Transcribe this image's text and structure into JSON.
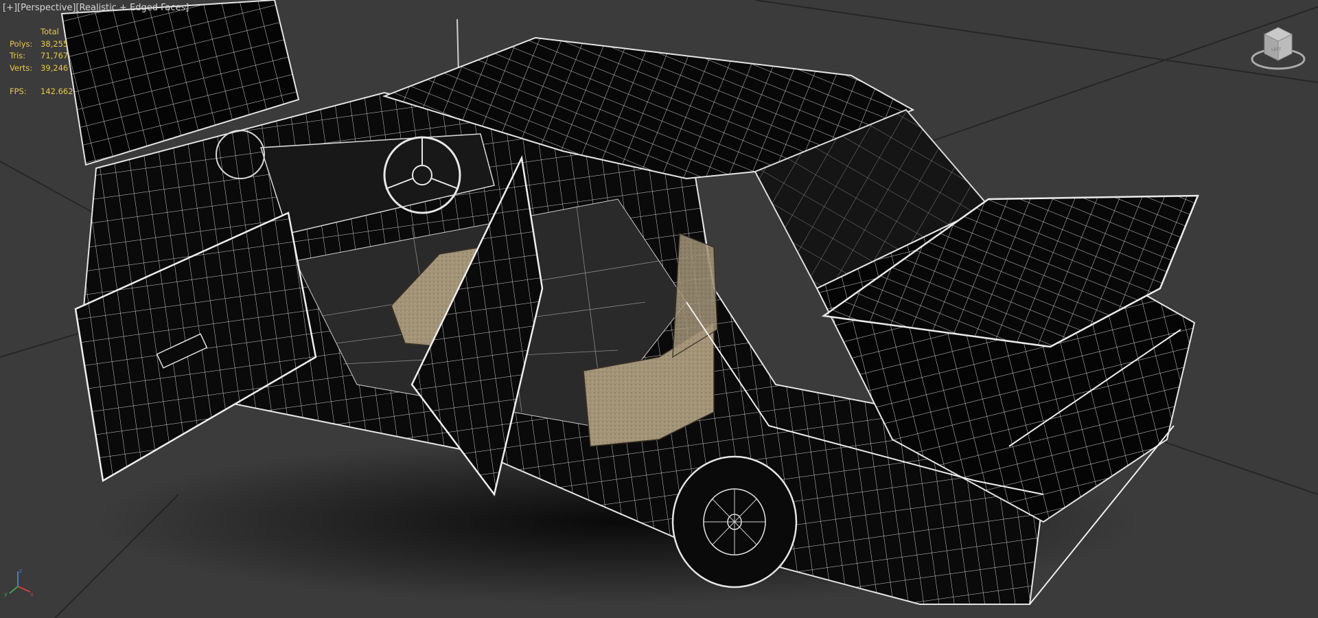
{
  "viewport": {
    "label_plus": "[+]",
    "label_view": "[Perspective]",
    "label_shading": "[Realistic + Edged Faces]"
  },
  "stats": {
    "header": "Total",
    "polys_label": "Polys:",
    "polys_value": "38,255",
    "tris_label": "Tris:",
    "tris_value": "71,767",
    "verts_label": "Verts:",
    "verts_value": "39,246",
    "fps_label": "FPS:",
    "fps_value": "142.662"
  },
  "viewcube": {
    "face_label": "LEFT"
  },
  "axis": {
    "x": "x",
    "y": "y",
    "z": "z"
  },
  "colors": {
    "background": "#3b3b3b",
    "wire": "#e0e0e0",
    "stats_text": "#e8c84a",
    "seat_fabric": "#a29378"
  }
}
